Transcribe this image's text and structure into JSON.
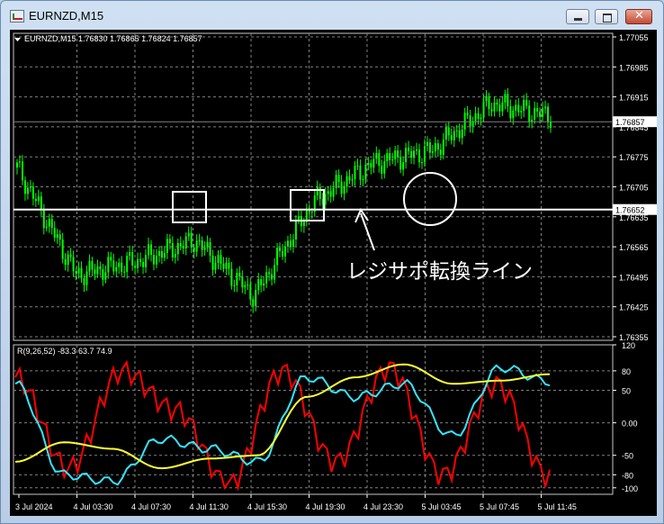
{
  "window": {
    "title": "EURNZD,M15",
    "icon": "chart-window-icon",
    "close_glyph": "✕"
  },
  "main_chart": {
    "header": "EURNZD,M15  1.76830 1.76865 1.76824 1.76857",
    "price_labels": [
      "1.77055",
      "1.76985",
      "1.76915",
      "1.76845",
      "1.76775",
      "1.76705",
      "1.76635",
      "1.76565",
      "1.76495",
      "1.76425",
      "1.76355"
    ],
    "current_price": "1.76857",
    "line_price": "1.76652",
    "annotation": "レジサポ転換ライン",
    "colors": {
      "candles": "#00ff00",
      "line": "#ffffff",
      "grid": "#808080"
    }
  },
  "indicator": {
    "header": "R(9,26,52) -83.3 63.7 74.9",
    "levels": [
      "120",
      "80",
      "50",
      "0.00",
      "-50",
      "-80",
      "-100"
    ],
    "colors": {
      "red": "#ff0000",
      "cyan": "#33e6ff",
      "yellow": "#ffff33"
    }
  },
  "time_axis": [
    "3 Jul 2024",
    "4 Jul 03:30",
    "4 Jul 07:30",
    "4 Jul 11:30",
    "4 Jul 15:30",
    "4 Jul 19:30",
    "4 Jul 23:30",
    "5 Jul 03:45",
    "5 Jul 07:45",
    "5 Jul 11:45"
  ],
  "chart_data": [
    {
      "type": "line",
      "title": "EURNZD,M15",
      "x": [
        "3 Jul 2024",
        "4 Jul 03:30",
        "4 Jul 07:30",
        "4 Jul 11:30",
        "4 Jul 15:30",
        "4 Jul 19:30",
        "4 Jul 23:30",
        "5 Jul 03:45",
        "5 Jul 07:45",
        "5 Jul 11:45"
      ],
      "series": [
        {
          "values": [
            1.7675,
            1.765,
            1.7653,
            1.7658,
            1.7645,
            1.7667,
            1.7676,
            1.7679,
            1.769,
            1.7687
          ]
        }
      ],
      "ylim": [
        1.76355,
        1.77055
      ],
      "hline": 1.76652,
      "last": 1.76857
    },
    {
      "type": "line",
      "title": "R(9,26,52) -83.3 63.7 74.9",
      "x": [
        "3 Jul 2024",
        "4 Jul 03:30",
        "4 Jul 07:30",
        "4 Jul 11:30",
        "4 Jul 15:30",
        "4 Jul 19:30",
        "4 Jul 23:30",
        "5 Jul 03:45",
        "5 Jul 07:45",
        "5 Jul 11:45"
      ],
      "series": [
        {
          "values": [
            70,
            -70,
            80,
            20,
            -95,
            80,
            -60,
            85,
            -80,
            60,
            -83.3
          ]
        },
        {
          "values": [
            60,
            -80,
            -90,
            -25,
            -40,
            -60,
            70,
            40,
            60,
            -20,
            85,
            63.7
          ]
        },
        {
          "values": [
            -60,
            -30,
            -40,
            -70,
            -55,
            -50,
            40,
            70,
            90,
            60,
            65,
            74.9
          ]
        }
      ],
      "ylim": [
        -110,
        120
      ]
    }
  ]
}
